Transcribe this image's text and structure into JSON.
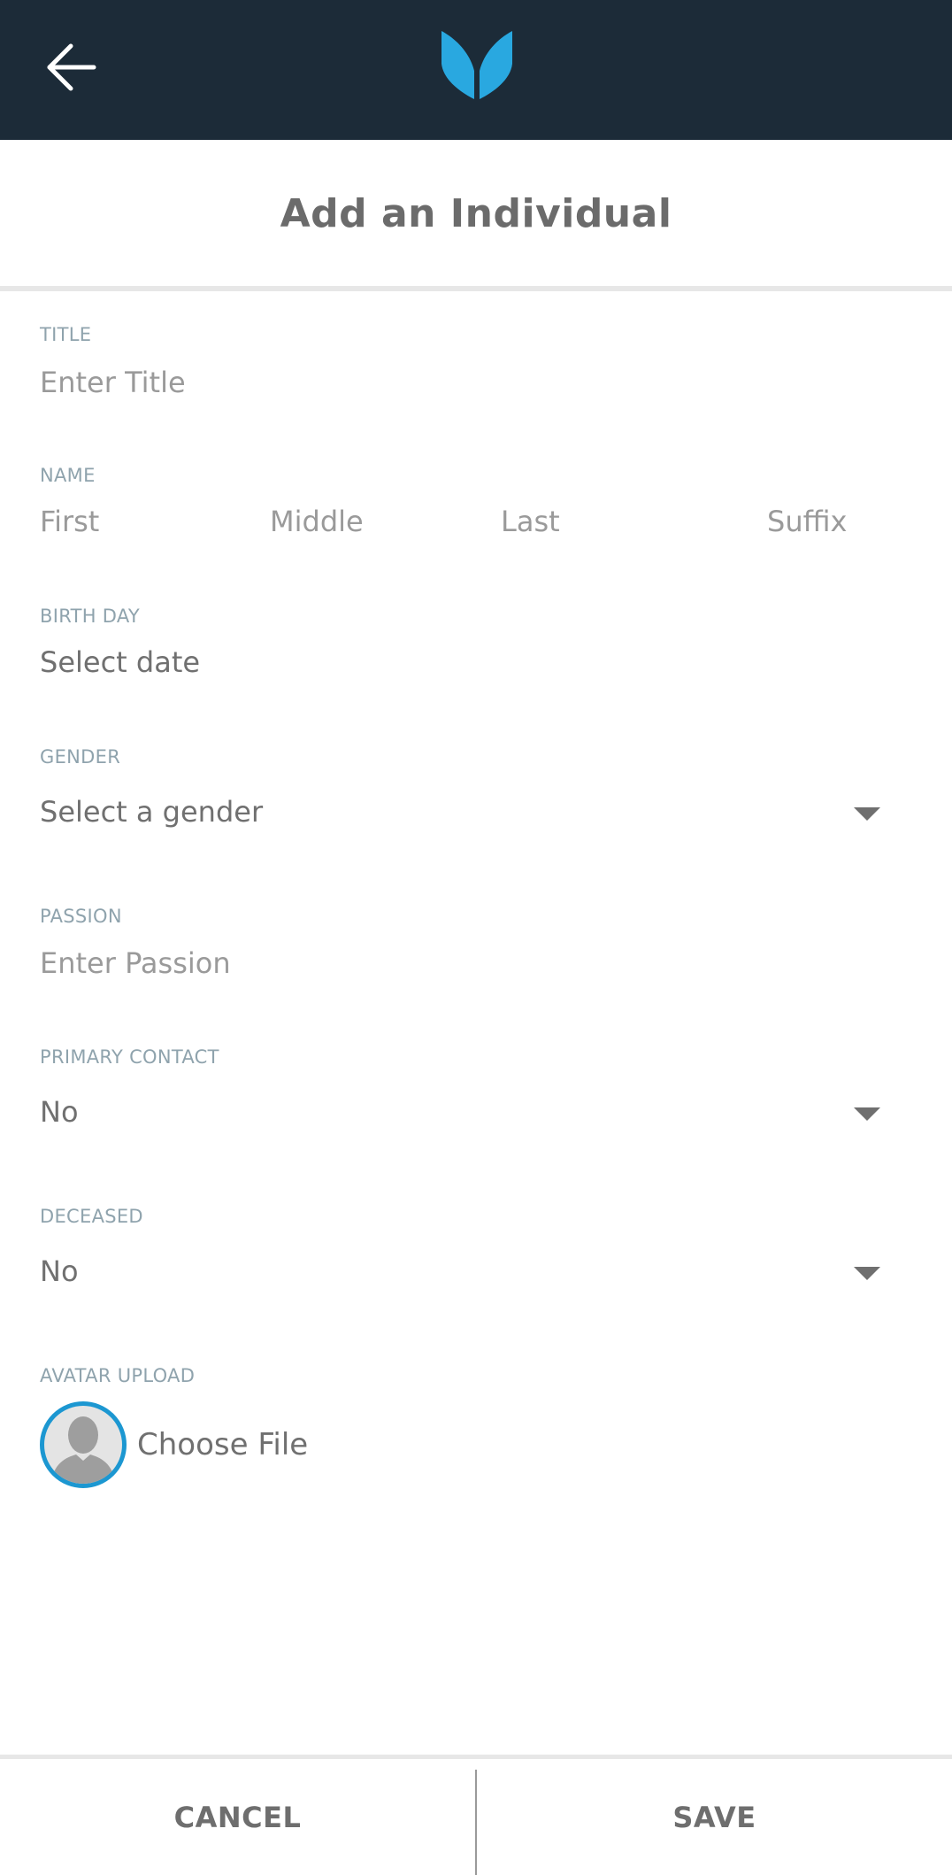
{
  "topbar": {
    "back_icon": "arrow-left-icon",
    "logo_icon": "book-logo-icon",
    "bg_color": "#1c2b38",
    "logo_color": "#29a8e0"
  },
  "header": {
    "title": "Add an Individual"
  },
  "form": {
    "title_field": {
      "label": "TITLE",
      "placeholder": "Enter Title"
    },
    "name_field": {
      "label": "NAME",
      "first_placeholder": "First",
      "middle_placeholder": "Middle",
      "last_placeholder": "Last",
      "suffix_placeholder": "Suffix"
    },
    "birthday_field": {
      "label": "BIRTH DAY",
      "value": "Select date"
    },
    "gender_field": {
      "label": "GENDER",
      "value": "Select a gender"
    },
    "passion_field": {
      "label": "PASSION",
      "placeholder": "Enter Passion"
    },
    "primary_contact_field": {
      "label": "PRIMARY CONTACT",
      "value": "No"
    },
    "deceased_field": {
      "label": "DECEASED",
      "value": "No"
    },
    "avatar_field": {
      "label": "AVATAR UPLOAD",
      "choose_label": "Choose File",
      "avatar_icon": "person-silhouette-icon"
    }
  },
  "footer": {
    "cancel_label": "CANCEL",
    "save_label": "SAVE"
  }
}
